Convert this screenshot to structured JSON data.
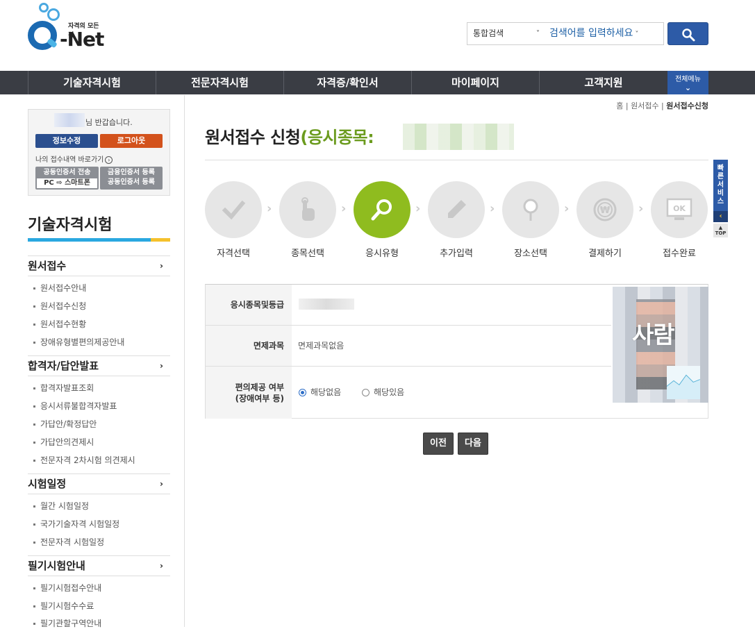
{
  "logo": {
    "tagline": "자격의 모든것",
    "name": "Net"
  },
  "search": {
    "scope": "통합검색",
    "placeholder": "검색어를 입력하세요"
  },
  "gnb": {
    "items": [
      "기술자격시험",
      "전문자격시험",
      "자격증/확인서",
      "마이페이지",
      "고객지원"
    ],
    "all_menu": "전체메뉴"
  },
  "login": {
    "greeting": "님 반갑습니다.",
    "edit_info": "정보수정",
    "logout": "로그아웃",
    "shortcut": "나의 접수내역 바로가기",
    "cert_transfer_line1": "공동인증서 전송",
    "cert_transfer_line2": "PC ⇨ 스마트폰",
    "cert_register_line1": "금융인증서 등록",
    "cert_register_line2": "공동인증서 등록"
  },
  "sidebar": {
    "title": "기술자격시험",
    "sections": [
      {
        "label": "원서접수",
        "items": [
          "원서접수안내",
          "원서접수신청",
          "원서접수현황",
          "장애유형별편의제공안내"
        ]
      },
      {
        "label": "합격자/답안발표",
        "items": [
          "합격자발표조회",
          "응시서류불합격자발표",
          "가답안/확정답안",
          "가답안의견제시",
          "전문자격 2차시험 의견제시"
        ]
      },
      {
        "label": "시험일정",
        "items": [
          "월간 시험일정",
          "국가기술자격 시험일정",
          "전문자격 시험일정"
        ]
      },
      {
        "label": "필기시험안내",
        "items": [
          "필기시험접수안내",
          "필기시험수수료",
          "필기관할구역안내"
        ]
      }
    ]
  },
  "breadcrumb": {
    "home": "홈",
    "parent": "원서접수",
    "current": "원서접수신청"
  },
  "page": {
    "title_prefix": "원서접수 신청",
    "title_paren": "(응시종목:"
  },
  "steps": [
    {
      "label": "자격선택",
      "icon": "check-icon",
      "active": false
    },
    {
      "label": "종목선택",
      "icon": "pointer-hand-icon",
      "active": false
    },
    {
      "label": "응시유형",
      "icon": "search-icon",
      "active": true
    },
    {
      "label": "추가입력",
      "icon": "pencil-icon",
      "active": false
    },
    {
      "label": "장소선택",
      "icon": "location-pin-icon",
      "active": false
    },
    {
      "label": "결제하기",
      "icon": "won-coin-icon",
      "active": false
    },
    {
      "label": "접수완료",
      "icon": "monitor-ok-icon",
      "active": false
    }
  ],
  "step_ok_text": "OK",
  "step_won_text": "₩",
  "form": {
    "row1_label": "응시종목및등급",
    "row2_label": "면제과목",
    "row2_value": "면제과목없음",
    "row3_label_line1": "편의제공 여부",
    "row3_label_line2": "(장애여부 등)",
    "radio_no": "해당없음",
    "radio_yes": "해당있음",
    "radio_selected": "해당없음"
  },
  "photo": {
    "label": "사람"
  },
  "buttons": {
    "prev": "이전",
    "next": "다음"
  },
  "quick": {
    "label": "빠른서비스",
    "top": "TOP"
  },
  "colors": {
    "primary_blue": "#2d5ba7",
    "nav_dark": "#3a3d44",
    "active_green": "#8fbc1f",
    "title_green": "#6b9b1e",
    "logout_orange": "#d3521c"
  }
}
